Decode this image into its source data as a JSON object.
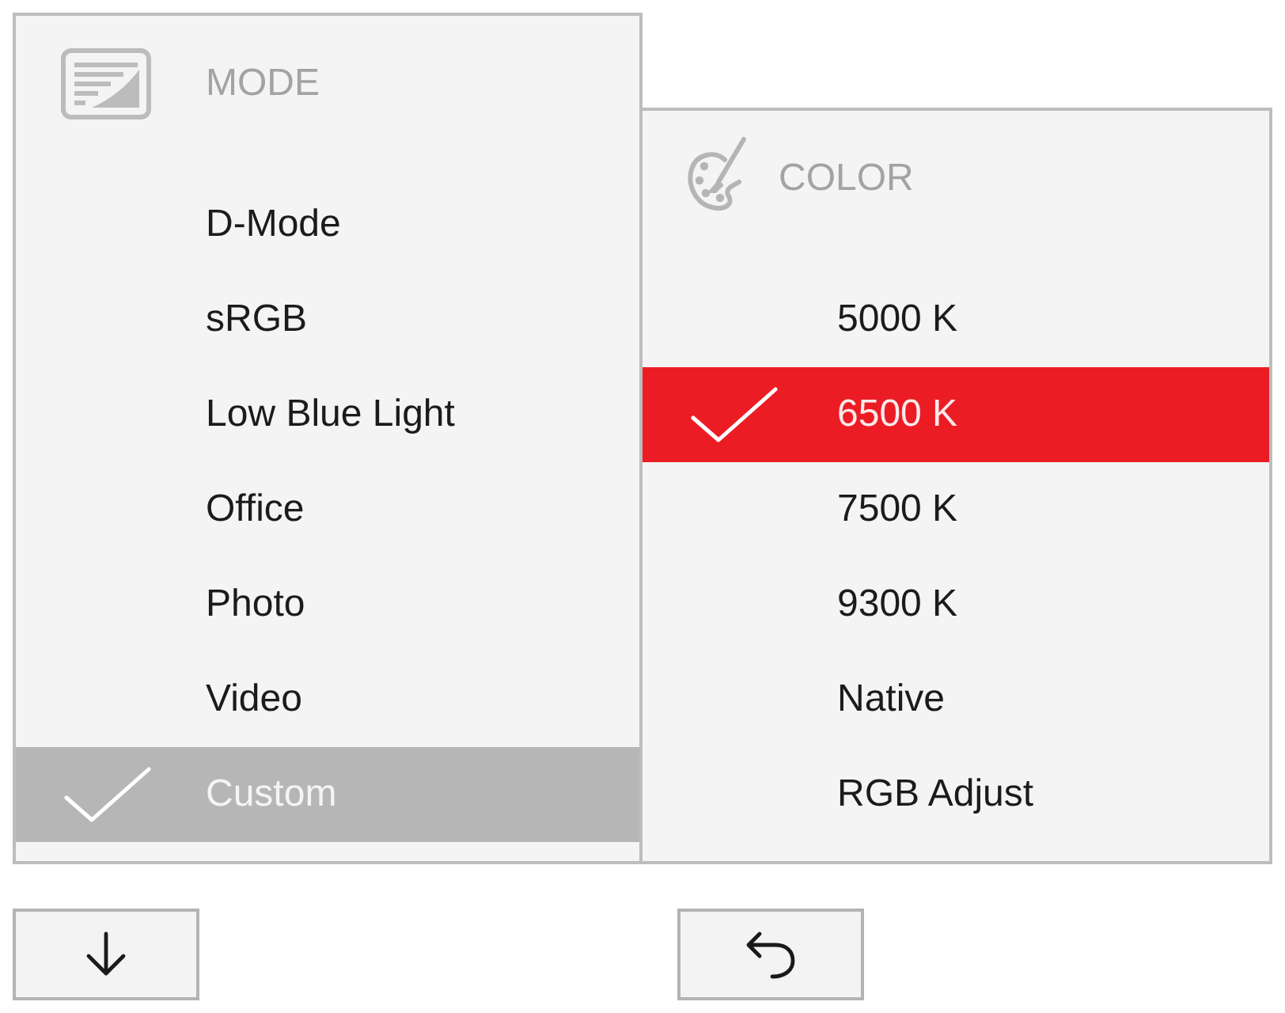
{
  "mode_menu": {
    "title": "MODE",
    "active": false,
    "items": [
      {
        "label": "D-Mode",
        "selected": false
      },
      {
        "label": "sRGB",
        "selected": false
      },
      {
        "label": "Low Blue Light",
        "selected": false
      },
      {
        "label": "Office",
        "selected": false
      },
      {
        "label": "Photo",
        "selected": false
      },
      {
        "label": "Video",
        "selected": false
      },
      {
        "label": "Custom",
        "selected": true
      }
    ]
  },
  "color_menu": {
    "title": "COLOR",
    "active": true,
    "items": [
      {
        "label": "5000 K",
        "selected": false
      },
      {
        "label": "6500 K",
        "selected": true
      },
      {
        "label": "7500 K",
        "selected": false
      },
      {
        "label": "9300 K",
        "selected": false
      },
      {
        "label": "Native",
        "selected": false
      },
      {
        "label": "RGB Adjust",
        "selected": false
      }
    ]
  },
  "buttons": [
    {
      "kind": "down"
    },
    {
      "kind": "back"
    }
  ]
}
